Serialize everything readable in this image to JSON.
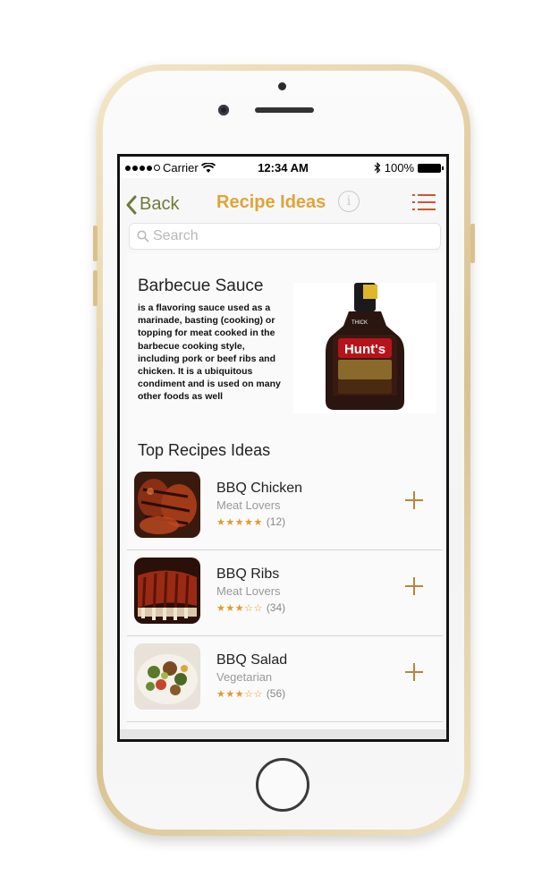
{
  "status_bar": {
    "carrier": "Carrier",
    "time": "12:34 AM",
    "battery": "100%"
  },
  "nav": {
    "back_label": "Back",
    "title": "Recipe Ideas",
    "info_glyph": "i"
  },
  "search": {
    "placeholder": "Search"
  },
  "info": {
    "title": "Barbecue Sauce",
    "description": "is a flavoring sauce used as a marinade, basting (cooking) or topping for meat cooked in the barbecue cooking style, including pork or beef ribs  and chicken. It is a ubiquitous condiment and is used on many other foods as well",
    "image_label": "Hunt's",
    "image_tag": "THICK"
  },
  "section": {
    "title": "Top Recipes Ideas"
  },
  "recipes": [
    {
      "name": "BBQ Chicken",
      "category": "Meat Lovers",
      "stars": "★★★★★",
      "count": "(12)",
      "rating": 5
    },
    {
      "name": "BBQ Ribs",
      "category": "Meat Lovers",
      "stars": "★★★☆☆",
      "count": "(34)",
      "rating": 3
    },
    {
      "name": "BBQ Salad",
      "category": "Vegetarian",
      "stars": "★★★☆☆",
      "count": "(56)",
      "rating": 3
    }
  ],
  "colors": {
    "title_accent": "#e0a43a",
    "back_green": "#6f7b3a",
    "menu_red": "#d4552b",
    "star_orange": "#e09a2c",
    "add_brown": "#b8853a"
  },
  "icons": {
    "back": "chevron-left-icon",
    "info": "info-icon",
    "menu": "menu-icon",
    "search": "search-icon",
    "add": "plus-icon"
  }
}
